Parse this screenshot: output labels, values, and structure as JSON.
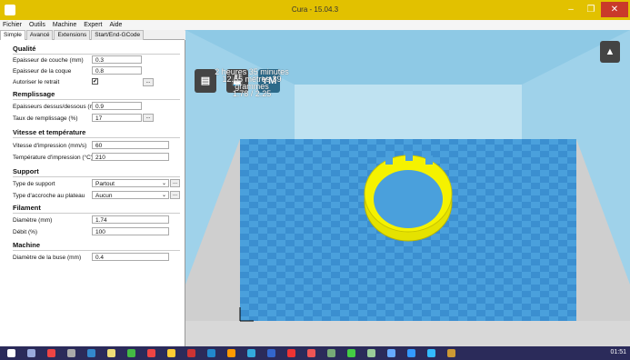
{
  "window": {
    "title": "Cura - 15.04.3"
  },
  "menu": [
    "Fichier",
    "Outils",
    "Machine",
    "Expert",
    "Aide"
  ],
  "tabs": [
    "Simple",
    "Avancé",
    "Extensions",
    "Start/End-GCode"
  ],
  "sections": {
    "qualite": {
      "title": "Qualité",
      "layer_height": {
        "label": "Epaisseur de couche (mm)",
        "value": "0.3"
      },
      "shell": {
        "label": "Epaisseur de la coque",
        "value": "0.8"
      },
      "retraction": {
        "label": "Autoriser le retrait",
        "checked": "✔"
      }
    },
    "remplissage": {
      "title": "Remplissage",
      "top_bottom": {
        "label": "Epaisseurs dessus/dessous (mm)",
        "value": "0.9"
      },
      "density": {
        "label": "Taux de remplissage (%)",
        "value": "17"
      }
    },
    "vitesse": {
      "title": "Vitesse et température",
      "speed": {
        "label": "Vitesse d'impression (mm/s)",
        "value": "60"
      },
      "temp": {
        "label": "Température d'impression (°C)",
        "value": "210"
      }
    },
    "support": {
      "title": "Support",
      "type": {
        "label": "Type de support",
        "value": "Partout"
      },
      "adhesion": {
        "label": "Type d'accroche au plateau",
        "value": "Aucun"
      }
    },
    "filament": {
      "title": "Filament",
      "diameter": {
        "label": "Diamètre (mm)",
        "value": "1.74"
      },
      "flow": {
        "label": "Débit (%)",
        "value": "100"
      }
    },
    "machine": {
      "title": "Machine",
      "nozzle": {
        "label": "Diamètre de la buse (mm)",
        "value": "0.4"
      }
    }
  },
  "viewport": {
    "time": "2 heures 35 minutes",
    "material": "12.65 mètres 39 grammes",
    "cost": "1.78 / 2.25",
    "ym_label": "YM"
  },
  "taskbar": {
    "clock": "01:51"
  },
  "colors": {
    "titlebar": "#e2c100",
    "accent": "#f0f000",
    "buildplate": "#3b8fd0"
  }
}
